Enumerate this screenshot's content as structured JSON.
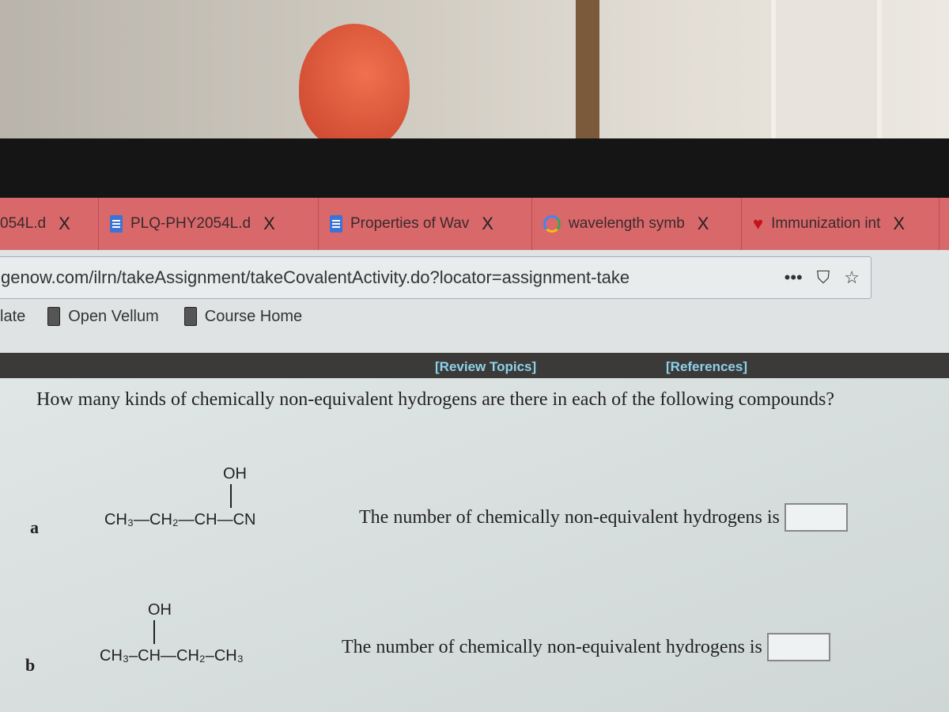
{
  "browser": {
    "tabs": [
      {
        "label": "054L.d",
        "icon": "none"
      },
      {
        "label": "PLQ-PHY2054L.d",
        "icon": "doc-icon"
      },
      {
        "label": "Properties of Wav",
        "icon": "doc-icon"
      },
      {
        "label": "wavelength symb",
        "icon": "google-icon"
      },
      {
        "label": "Immunization int",
        "icon": "heart-icon"
      }
    ],
    "close_glyph": "X",
    "url": "genow.com/ilrn/takeAssignment/takeCovalentActivity.do?locator=assignment-take",
    "url_icons": {
      "more": "•••",
      "pocket": "⛉",
      "star": "☆"
    },
    "bookmarks": [
      "late",
      "Open Vellum",
      "Course Home"
    ]
  },
  "colors": {
    "tab_bar": "#d9686b",
    "review_bar": "#3b3a38",
    "link": "#8ed2ea"
  },
  "assignment": {
    "review_topics": "[Review Topics]",
    "references": "[References]",
    "question": "How many kinds of chemically non-equivalent hydrogens are there in each of the following compounds?",
    "items": [
      {
        "label": "a",
        "substituent": "OH",
        "formula": "CH₃—CH₂—CH—CN",
        "prompt": "The number of chemically non-equivalent hydrogens is",
        "answer": ""
      },
      {
        "label": "b",
        "substituent": "OH",
        "formula": "CH₃–CH—CH₂–CH₃",
        "prompt": "The number of chemically non-equivalent hydrogens is",
        "answer": ""
      }
    ]
  }
}
